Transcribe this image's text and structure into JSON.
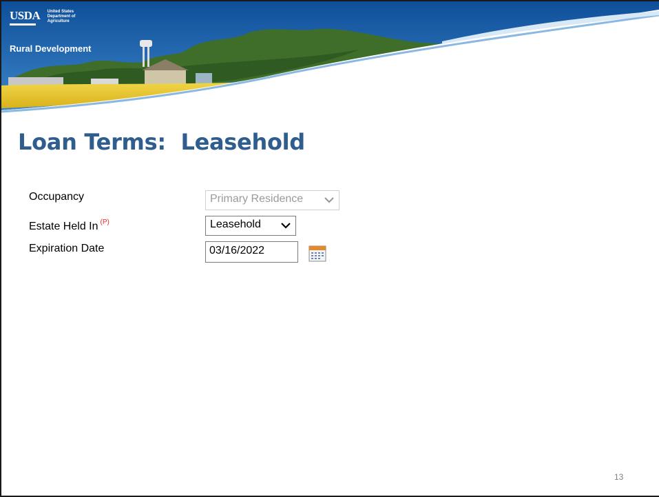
{
  "banner": {
    "logo_text": "USDA",
    "agency_lines": [
      "United States",
      "Department of",
      "Agriculture"
    ],
    "agency_name": "Rural Development"
  },
  "page_title": "Loan Terms:  Leasehold",
  "form": {
    "occupancy": {
      "label": "Occupancy",
      "value": "Primary Residence",
      "disabled": true
    },
    "estate_held_in": {
      "label": "Estate Held In",
      "required_marker": "(P)",
      "value": "Leasehold"
    },
    "expiration_date": {
      "label": "Expiration Date",
      "value": "03/16/2022"
    }
  },
  "icons": {
    "dropdown": "chevron-down-icon",
    "date_picker": "calendar-icon"
  },
  "colors": {
    "title": "#2e5d8e",
    "banner_blue": "#1c5aa6",
    "required": "#e32b2b"
  },
  "page_number": "13"
}
